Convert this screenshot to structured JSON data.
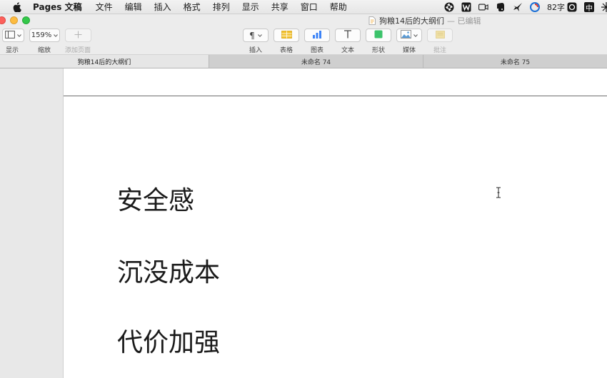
{
  "menubar": {
    "app_name": "Pages 文稿",
    "items": [
      "文件",
      "编辑",
      "插入",
      "格式",
      "排列",
      "显示",
      "共享",
      "窗口",
      "帮助"
    ],
    "word_count": "82字",
    "input_method": "中"
  },
  "window": {
    "title": "狗粮14后的大纲们",
    "status": "— 已编辑"
  },
  "toolbar": {
    "view_label": "显示",
    "zoom_value": "159%",
    "zoom_label": "缩放",
    "add_page_label": "添加页面",
    "insert_label": "插入",
    "table_label": "表格",
    "chart_label": "图表",
    "text_label": "文本",
    "shape_label": "形状",
    "media_label": "媒体",
    "comment_label": "批注"
  },
  "tabs": [
    {
      "label": "狗粮14后的大纲们",
      "active": true
    },
    {
      "label": "未命名 74",
      "active": false
    },
    {
      "label": "未命名 75",
      "active": false
    }
  ],
  "document": {
    "headings": [
      "安全感",
      "沉没成本",
      "代价加强"
    ]
  },
  "colors": {
    "table_icon": "#f2c12e",
    "chart_icon": "#3b82f6",
    "shape_icon": "#3cc36b",
    "media_icon": "#5b9bd5",
    "comment_icon": "#f5d76e"
  }
}
